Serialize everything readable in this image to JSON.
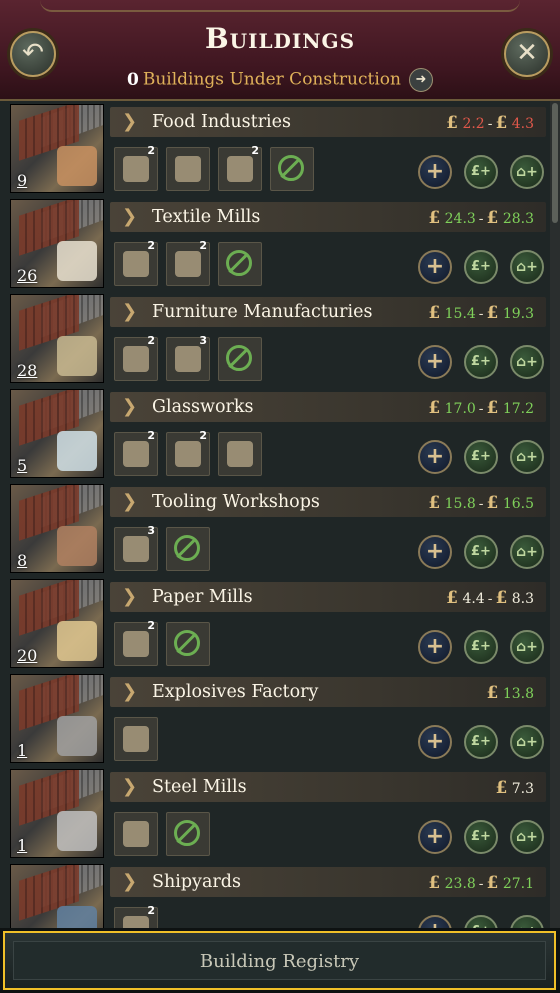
{
  "header": {
    "title": "Buildings",
    "under_construction_count": "0",
    "under_construction_label": "Buildings Under Construction",
    "back_icon": "back-arrow-icon",
    "close_icon": "close-icon"
  },
  "currency_symbol": "£",
  "buildings": [
    {
      "name": "Food Industries",
      "count": "9",
      "cost_min": "2.2",
      "cost_max": "4.3",
      "cost_color": "red",
      "methods": [
        {
          "icon": "tool-method-icon",
          "badge": "2"
        },
        {
          "icon": "disabled-method-icon",
          "badge": ""
        },
        {
          "icon": "worker-method-icon",
          "badge": "2"
        },
        {
          "icon": "automation-gear-icon",
          "badge": ""
        }
      ]
    },
    {
      "name": "Textile Mills",
      "count": "26",
      "cost_min": "24.3",
      "cost_max": "28.3",
      "cost_color": "green",
      "methods": [
        {
          "icon": "loom-method-icon",
          "badge": "2"
        },
        {
          "icon": "dress-form-icon",
          "badge": "2"
        },
        {
          "icon": "automation-gear-icon",
          "badge": ""
        }
      ]
    },
    {
      "name": "Furniture Manufacturies",
      "count": "28",
      "cost_min": "15.4",
      "cost_max": "19.3",
      "cost_color": "green",
      "methods": [
        {
          "icon": "lathe-method-icon",
          "badge": "2"
        },
        {
          "icon": "armchair-icon",
          "badge": "3"
        },
        {
          "icon": "automation-gear-icon",
          "badge": ""
        }
      ]
    },
    {
      "name": "Glassworks",
      "count": "5",
      "cost_min": "17.0",
      "cost_max": "17.2",
      "cost_color": "green",
      "methods": [
        {
          "icon": "goblet-icon",
          "badge": "2"
        },
        {
          "icon": "teapot-icon",
          "badge": "2"
        },
        {
          "icon": "glass-blowing-icon",
          "badge": ""
        }
      ]
    },
    {
      "name": "Tooling Workshops",
      "count": "8",
      "cost_min": "15.8",
      "cost_max": "16.5",
      "cost_color": "green",
      "methods": [
        {
          "icon": "crucible-icon",
          "badge": "3"
        },
        {
          "icon": "automation-gear-icon",
          "badge": ""
        }
      ]
    },
    {
      "name": "Paper Mills",
      "count": "20",
      "cost_min": "4.4",
      "cost_max": "8.3",
      "cost_color": "white",
      "methods": [
        {
          "icon": "paper-stack-icon",
          "badge": "2"
        },
        {
          "icon": "automation-gear-icon",
          "badge": ""
        }
      ]
    },
    {
      "name": "Explosives Factory",
      "count": "1",
      "cost_min": "",
      "cost_max": "13.8",
      "cost_color": "green",
      "methods": [
        {
          "icon": "flask-icon",
          "badge": ""
        }
      ]
    },
    {
      "name": "Steel Mills",
      "count": "1",
      "cost_min": "",
      "cost_max": "7.3",
      "cost_color": "white",
      "methods": [
        {
          "icon": "furnace-icon",
          "badge": ""
        },
        {
          "icon": "automation-gear-icon",
          "badge": ""
        }
      ]
    },
    {
      "name": "Shipyards",
      "count": "",
      "cost_min": "23.8",
      "cost_max": "27.1",
      "cost_color": "green",
      "methods": [
        {
          "icon": "shipyard-method-icon",
          "badge": "2"
        }
      ]
    }
  ],
  "action_buttons": {
    "add": "+",
    "fund": "£+",
    "home": "⌂+"
  },
  "footer": {
    "button_label": "Building Registry"
  },
  "colors": {
    "accent": "#f0c028",
    "header": "#4a1c28",
    "cost_red": "#e0584a",
    "cost_green": "#7fd05a"
  }
}
